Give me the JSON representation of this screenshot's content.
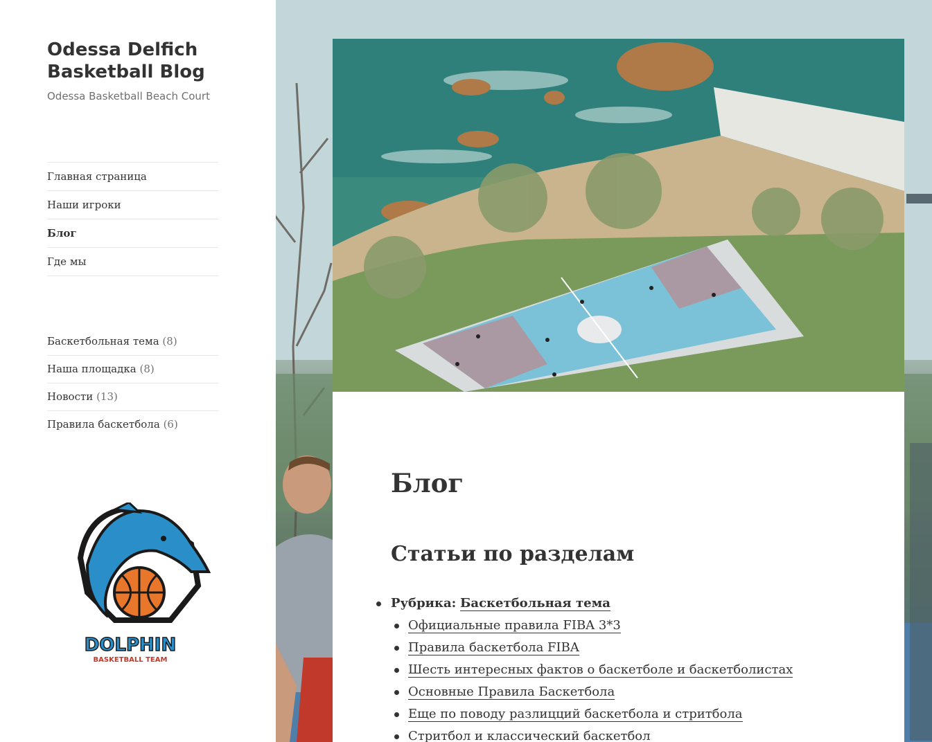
{
  "site": {
    "title": "Odessa Delfich Basketball Blog",
    "description": "Odessa Basketball Beach Court"
  },
  "menu": [
    {
      "label": "Главная страница",
      "current": false
    },
    {
      "label": "Наши игроки",
      "current": false
    },
    {
      "label": "Блог",
      "current": true
    },
    {
      "label": "Где мы",
      "current": false
    }
  ],
  "categories": [
    {
      "label": "Баскетбольная тема",
      "count": "(8)"
    },
    {
      "label": "Наша площадка",
      "count": "(8)"
    },
    {
      "label": "Новости",
      "count": "(13)"
    },
    {
      "label": "Правила баскетбола",
      "count": "(6)"
    }
  ],
  "logo": {
    "name": "DOLPHIN",
    "tagline": "BASKETBALL TEAM",
    "colors": {
      "blue": "#2a8fc9",
      "dark": "#1a1a1a",
      "orange": "#e8762b",
      "red": "#c0392b"
    }
  },
  "article": {
    "title": "Блог",
    "section_title": "Статьи по разделам",
    "rubric_label": "Рубрика:",
    "rubric_link": "Баскетбольная тема",
    "posts": [
      "Официальные правила FIBA 3*3",
      "Правила баскетбола FIBA",
      "Шесть интересных фактов о баскетболе и баскетболистах",
      "Основные Правила Баскетбола",
      "Еще по поводу разлицций баскетбола и стритбола",
      "Стритбол и классический баскетбол"
    ]
  }
}
